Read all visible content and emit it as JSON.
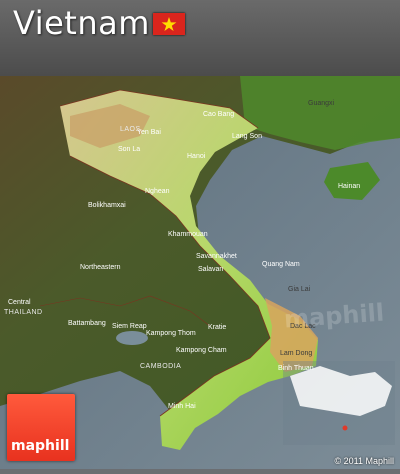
{
  "header": {
    "title": "Vietnam"
  },
  "flag": {
    "color": "#da251d",
    "star_color": "#ffdd00"
  },
  "map": {
    "labels": [
      "Guangxi",
      "LAOS",
      "Yen Bai",
      "Cao Bang",
      "Lang Son",
      "Son La",
      "Hanoi",
      "Nghean",
      "Bolikhamxai",
      "Khammouan",
      "Hainan",
      "Savannakhet",
      "Salavan",
      "Northeastern",
      "Quang Nam",
      "Gia Lai",
      "Dac Lac",
      "Lam Dong",
      "Binh Thuan",
      "Kampong Cham",
      "Kratie",
      "Battambang",
      "Siem Reap",
      "Kampong Thom",
      "CAMBODIA",
      "Minh Hai",
      "THAILAND",
      "Central"
    ]
  },
  "watermark": "maphill",
  "logo": {
    "text": "maphill"
  },
  "copyright": "© 2011 Maphill"
}
